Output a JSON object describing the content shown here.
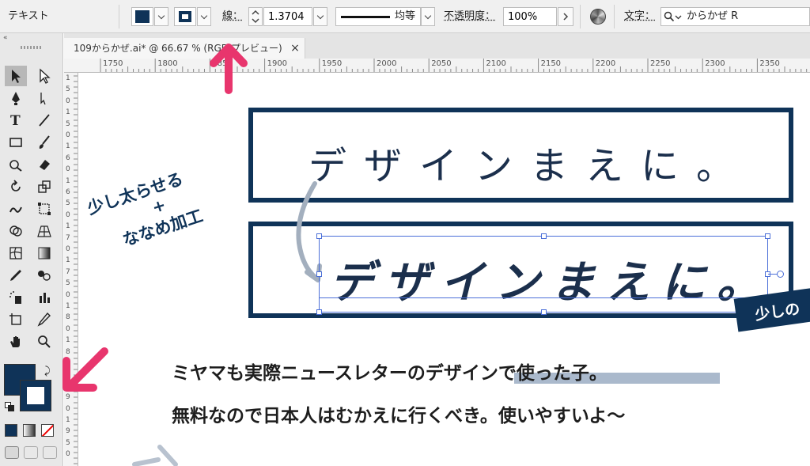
{
  "control_bar": {
    "mode_label": "テキスト",
    "stroke_label": "線：",
    "stroke_value": "1.3704",
    "stroke_profile": "均等",
    "opacity_label": "不透明度：",
    "opacity_value": "100%",
    "font_label": "文字：",
    "font_value": "からかぜ R"
  },
  "tab": {
    "title": "109からかぜ.ai* @ 66.67 % (RGB/プレビュー)",
    "close_label": "×"
  },
  "h_ruler": {
    "labels": [
      "1750",
      "1800",
      "1850",
      "1900",
      "1950",
      "2000",
      "2050",
      "2100",
      "2150",
      "2200",
      "2250",
      "2300",
      "2350"
    ]
  },
  "v_ruler": {
    "labels": [
      "1",
      "5",
      "0",
      "1",
      "5",
      "0",
      "1",
      "6",
      "0",
      "1",
      "6",
      "5",
      "0",
      "1",
      "7",
      "0",
      "1",
      "7",
      "5",
      "0",
      "1",
      "8",
      "0",
      "1",
      "8",
      "5",
      "0",
      "1",
      "9",
      "0",
      "1",
      "9",
      "5",
      "0"
    ]
  },
  "canvas": {
    "top_text": "デザインまえに。",
    "bottom_text": "デザインまえに。",
    "annotation_line1": "少し太らせる",
    "annotation_plus": "+",
    "annotation_line2": "ななめ加工",
    "badge_text": "少しの",
    "caption_line1": "ミヤマも実際ニュースレターのデザインで使った子。",
    "caption_line2": "無料なので日本人はむかえに行くべき。使いやすいよ〜"
  },
  "colors": {
    "navy": "#0f3358",
    "pink": "#e8356d",
    "highlight": "#aab9cc",
    "selection": "#4b6fd8"
  }
}
